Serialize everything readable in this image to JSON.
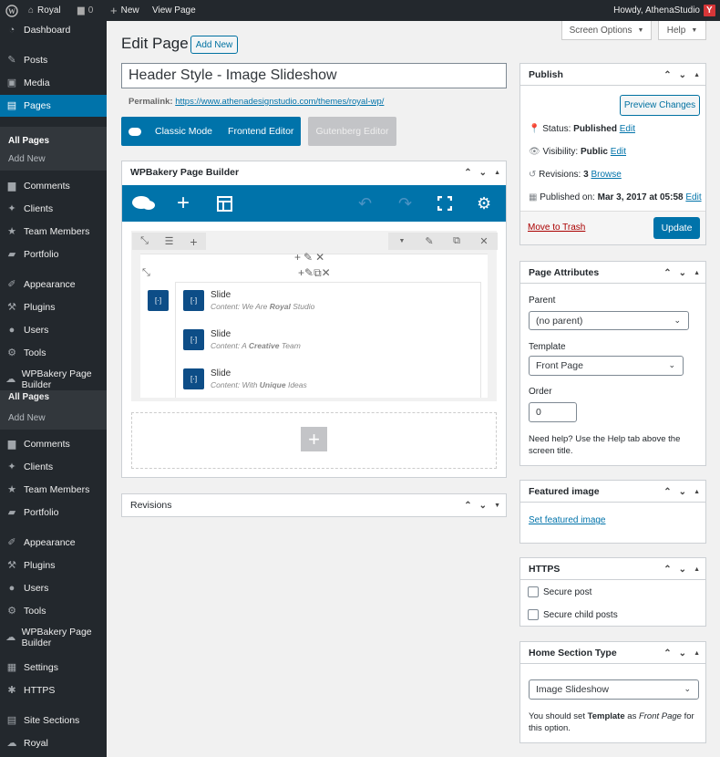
{
  "adminbar": {
    "site": "Royal",
    "comments": "0",
    "new": "New",
    "view": "View Page",
    "howdy": "Howdy, AthenaStudio"
  },
  "sidebar": {
    "top": [
      {
        "label": "Dashboard",
        "icon": "dashboard-icon"
      },
      {
        "label": "Posts",
        "icon": "pin-icon"
      },
      {
        "label": "Media",
        "icon": "media-icon"
      },
      {
        "label": "Pages",
        "icon": "pages-icon"
      }
    ],
    "pages_sub": [
      "All Pages",
      "Add New"
    ],
    "mid": [
      {
        "label": "Comments",
        "icon": "comments-icon"
      },
      {
        "label": "Clients",
        "icon": "clients-icon"
      },
      {
        "label": "Team Members",
        "icon": "team-icon"
      },
      {
        "label": "Portfolio",
        "icon": "portfolio-icon"
      },
      {
        "label": "Appearance",
        "icon": "appearance-icon"
      },
      {
        "label": "Plugins",
        "icon": "plugins-icon"
      },
      {
        "label": "Users",
        "icon": "users-icon"
      },
      {
        "label": "Tools",
        "icon": "tools-icon"
      },
      {
        "label": "WPBakery Page Builder",
        "icon": "wpbakery-icon"
      }
    ],
    "flyout": [
      "All Pages",
      "Add New"
    ],
    "lower": [
      {
        "label": "Comments",
        "icon": "comments-icon"
      },
      {
        "label": "Clients",
        "icon": "clients-icon"
      },
      {
        "label": "Team Members",
        "icon": "team-icon"
      },
      {
        "label": "Portfolio",
        "icon": "portfolio-icon"
      },
      {
        "label": "Appearance",
        "icon": "appearance-icon"
      },
      {
        "label": "Plugins",
        "icon": "plugins-icon"
      },
      {
        "label": "Users",
        "icon": "users-icon"
      },
      {
        "label": "Tools",
        "icon": "tools-icon"
      },
      {
        "label": "WPBakery Page Builder",
        "icon": "wpbakery-icon"
      },
      {
        "label": "Settings",
        "icon": "settings-icon"
      },
      {
        "label": "HTTPS",
        "icon": "https-icon"
      },
      {
        "label": "Site Sections",
        "icon": "sections-icon"
      },
      {
        "label": "Royal",
        "icon": "royal-icon"
      }
    ]
  },
  "header": {
    "title": "Edit Page",
    "add_new": "Add New",
    "screen_options": "Screen Options",
    "help": "Help"
  },
  "editor": {
    "post_title": "Header Style - Image Slideshow",
    "permalink_label": "Permalink:",
    "permalink_url": "https://www.athenadesignstudio.com/themes/royal-wp/",
    "classic_mode": "Classic Mode",
    "frontend_editor": "Frontend Editor",
    "gutenberg_editor": "Gutenberg Editor"
  },
  "wpbakery": {
    "title": "WPBakery Page Builder",
    "slides": [
      {
        "title": "Slide",
        "prefix": "Content: We Are ",
        "bold": "Royal",
        "suffix": " Studio"
      },
      {
        "title": "Slide",
        "prefix": "Content: A ",
        "bold": "Creative",
        "suffix": " Team"
      },
      {
        "title": "Slide",
        "prefix": "Content: With ",
        "bold": "Unique",
        "suffix": " Ideas"
      }
    ]
  },
  "revisions_box": {
    "title": "Revisions"
  },
  "publish": {
    "title": "Publish",
    "preview": "Preview Changes",
    "status_label": "Status:",
    "status_value": "Published",
    "visibility_label": "Visibility:",
    "visibility_value": "Public",
    "revisions_label": "Revisions:",
    "revisions_value": "3",
    "browse": "Browse",
    "published_label": "Published on:",
    "published_value": "Mar 3, 2017 at 05:58",
    "edit": "Edit",
    "trash": "Move to Trash",
    "update": "Update"
  },
  "attributes": {
    "title": "Page Attributes",
    "parent_label": "Parent",
    "parent_value": "(no parent)",
    "template_label": "Template",
    "template_value": "Front Page",
    "order_label": "Order",
    "order_value": "0",
    "help": "Need help? Use the Help tab above the screen title."
  },
  "featured": {
    "title": "Featured image",
    "set": "Set featured image"
  },
  "https": {
    "title": "HTTPS",
    "secure_post": "Secure post",
    "secure_child": "Secure child posts"
  },
  "home_section": {
    "title": "Home Section Type",
    "value": "Image Slideshow",
    "note_pre": "You should set ",
    "note_b": "Template",
    "note_mid": " as ",
    "note_i": "Front Page",
    "note_post": " for this option."
  },
  "colors": {
    "accent": "#0073aa",
    "sidebar": "#23282d",
    "vc_icon": "#0d4d87",
    "trash": "#a00"
  }
}
